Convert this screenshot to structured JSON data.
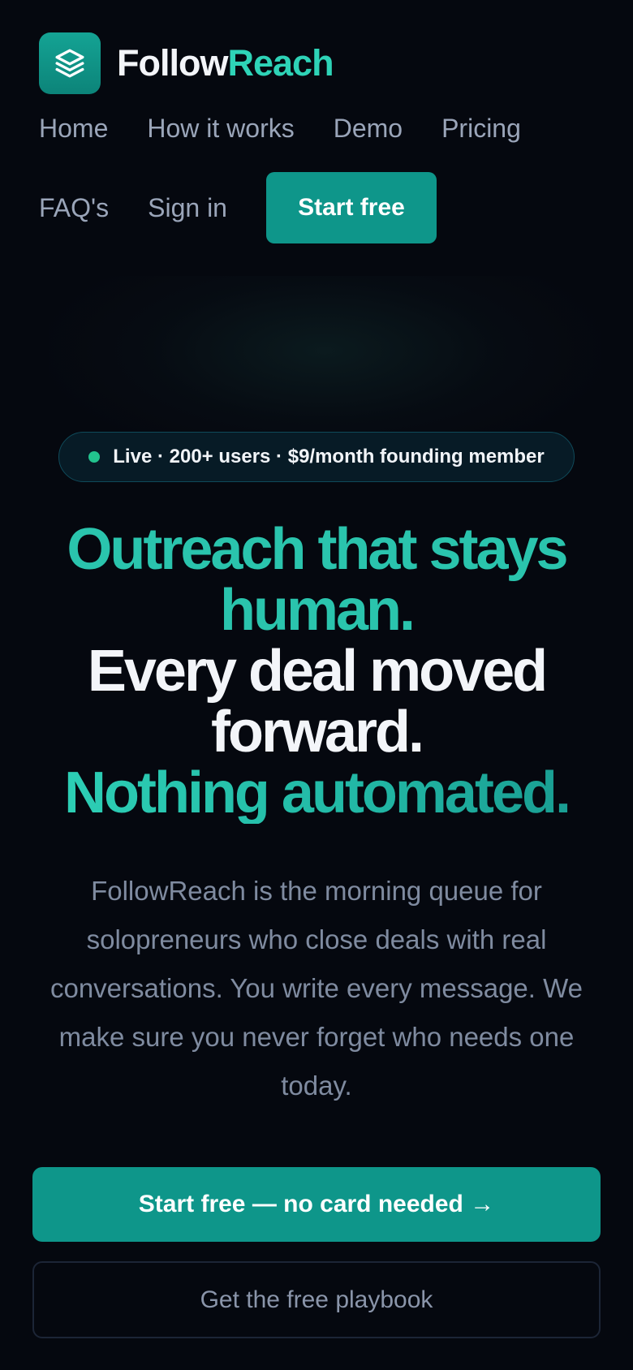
{
  "brand": {
    "name_part1": "Follow",
    "name_part2": "Reach",
    "logo_icon": "stacked-layers-icon",
    "accent_color": "#2ed3b7",
    "logo_color": "#0f968a"
  },
  "nav": {
    "items": [
      {
        "label": "Home"
      },
      {
        "label": "How it works"
      },
      {
        "label": "Demo"
      },
      {
        "label": "Pricing"
      },
      {
        "label": "FAQ's"
      },
      {
        "label": "Sign in"
      }
    ],
    "cta_label": "Start free"
  },
  "badge": {
    "text": "Live · 200+ users · $9/month founding member",
    "dot_color": "#22c38e"
  },
  "headline": {
    "line1": "Outreach that stays",
    "line2": "human.",
    "line3": "Every deal moved",
    "line4": "forward.",
    "line5": "Nothing automated."
  },
  "description": "FollowReach is the morning queue for solopreneurs who close deals with real conversations. You write every message. We make sure you never forget who needs one today.",
  "buttons": {
    "primary_label": "Start free — no card needed →",
    "secondary_label": "Get the free playbook"
  },
  "colors": {
    "background": "#05080f",
    "primary_button": "#0e968a",
    "text_muted": "#7f8ba0"
  }
}
